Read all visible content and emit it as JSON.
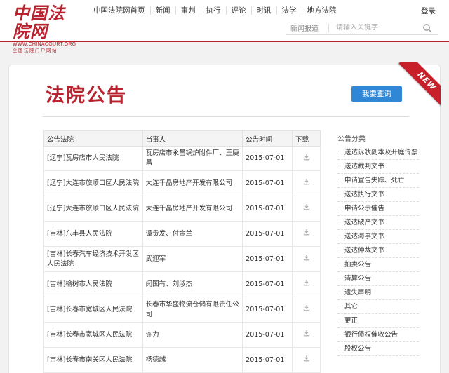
{
  "header": {
    "logo_main": "中国法院网",
    "logo_url": "WWW.CHINACOURT.ORG",
    "logo_sub": "全国法院门户网站",
    "nav": [
      "中国法院网首页",
      "新闻",
      "审判",
      "执行",
      "评论",
      "时讯",
      "法学",
      "地方法院"
    ],
    "login": "登录",
    "search_category": "新闻报道",
    "search_placeholder": "请输入关键字"
  },
  "page": {
    "title": "法院公告",
    "query_button": "我要查询",
    "ribbon": "NEW"
  },
  "table": {
    "headers": [
      "公告法院",
      "当事人",
      "公告时间",
      "下载"
    ],
    "rows": [
      {
        "court": "[辽宁]瓦房店市人民法院",
        "party": "瓦房店市永昌锅炉附件厂、王庚昌",
        "date": "2015-07-01"
      },
      {
        "court": "[辽宁]大连市旅顺口区人民法院",
        "party": "大连千晶房地产开发有限公司",
        "date": "2015-07-01"
      },
      {
        "court": "[辽宁]大连市旅顺口区人民法院",
        "party": "大连千晶房地产开发有限公司",
        "date": "2015-07-01"
      },
      {
        "court": "[吉林]东丰县人民法院",
        "party": "谭贵发、付金兰",
        "date": "2015-07-01"
      },
      {
        "court": "[吉林]长春汽车经济技术开发区人民法院",
        "party": "武迎军",
        "date": "2015-07-01"
      },
      {
        "court": "[吉林]榆树市人民法院",
        "party": "闵国有、刘淑杰",
        "date": "2015-07-01"
      },
      {
        "court": "[吉林]长春市宽城区人民法院",
        "party": "长春市华盛物流仓储有限责任公司",
        "date": "2015-07-01"
      },
      {
        "court": "[吉林]长春市宽城区人民法院",
        "party": "许力",
        "date": "2015-07-01"
      },
      {
        "court": "[吉林]长春市南关区人民法院",
        "party": "杨德越",
        "date": "2015-07-01"
      }
    ]
  },
  "categories": {
    "title": "公告分类",
    "items": [
      "送达诉状副本及开庭传票",
      "送达裁判文书",
      "申请宣告失踪、死亡",
      "送达执行文书",
      "申请公示催告",
      "送达破产文书",
      "送达海事文书",
      "送达仲裁文书",
      "拍卖公告",
      "清算公告",
      "遗失声明",
      "其它",
      "更正",
      "银行债权催收公告",
      "股权公告"
    ]
  },
  "colors": {
    "brand": "#b8232f",
    "button": "#2f87d6",
    "ribbon": "#c8202b"
  }
}
